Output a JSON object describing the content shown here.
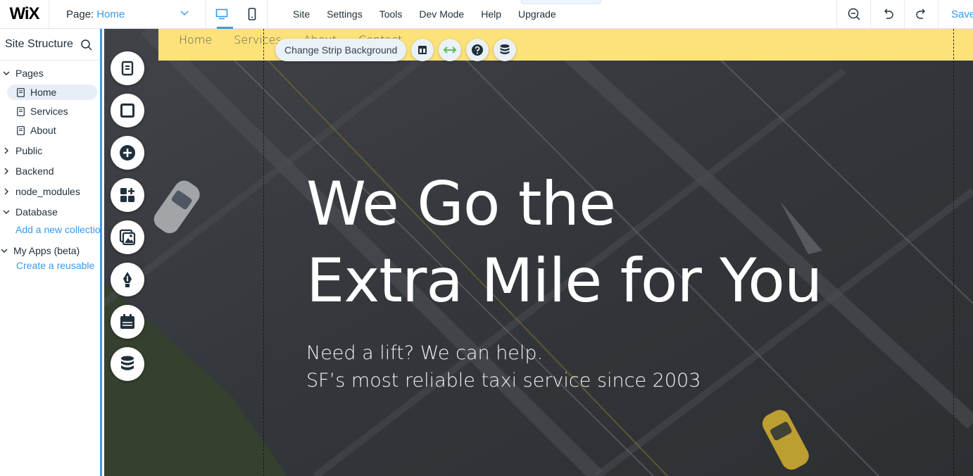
{
  "topbar": {
    "logo": "WiX",
    "page_prefix": "Page:",
    "page_value": "Home",
    "menu": [
      "Site",
      "Settings",
      "Tools",
      "Dev Mode",
      "Help",
      "Upgrade"
    ],
    "save_label": "Save"
  },
  "site_structure": {
    "title": "Site Structure",
    "pages_label": "Pages",
    "pages": [
      "Home",
      "Services",
      "About"
    ],
    "public_label": "Public",
    "backend_label": "Backend",
    "node_modules_label": "node_modules",
    "database_label": "Database",
    "add_collection_link": "Add a new collection",
    "my_apps_label": "My Apps (beta)",
    "create_reusable_link": "Create a reusable"
  },
  "canvas": {
    "nav": [
      "Home",
      "Services",
      "About",
      "Contact"
    ],
    "toolbar": {
      "change_bg_label": "Change Strip Background"
    },
    "hero": {
      "title_line1": "We Go the",
      "title_line2": "Extra Mile for You",
      "sub_line1": "Need a lift? We can help.",
      "sub_line2": "SF’s most reliable taxi service since 2003"
    }
  },
  "colors": {
    "accent": "#3899ec",
    "header_strip": "#fde27a",
    "active_green": "#60bc57"
  },
  "icons": {
    "rail": [
      "pages-icon",
      "strip-icon",
      "add-icon",
      "app-market-icon",
      "media-icon",
      "pen-icon",
      "bookings-icon",
      "database-icon"
    ]
  }
}
